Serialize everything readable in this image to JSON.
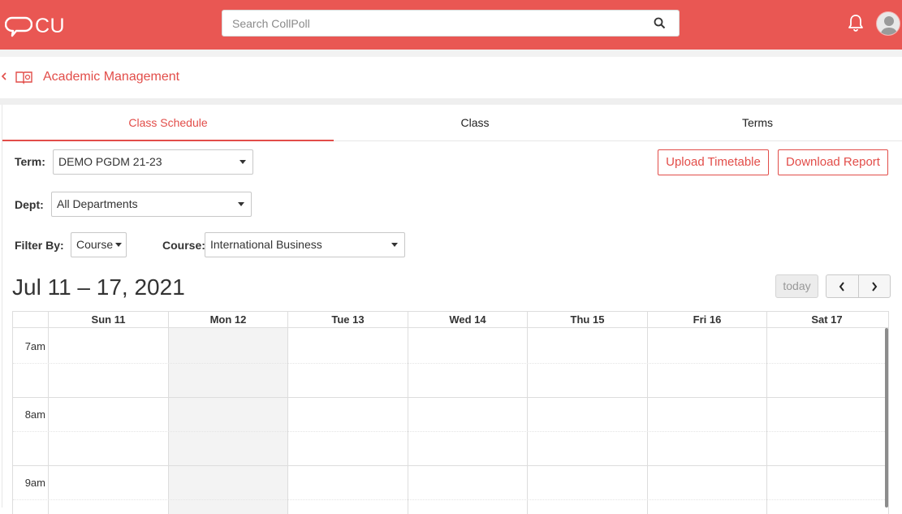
{
  "app": {
    "brand": "CU"
  },
  "header": {
    "search_placeholder": "Search CollPoll"
  },
  "breadcrumb": {
    "title": "Academic Management"
  },
  "tabs": [
    {
      "label": "Class Schedule",
      "active": true
    },
    {
      "label": "Class",
      "active": false
    },
    {
      "label": "Terms",
      "active": false
    }
  ],
  "filters": {
    "term_label": "Term:",
    "term_value": "DEMO PGDM 21-23",
    "dept_label": "Dept:",
    "dept_value": "All Departments",
    "filter_by_label": "Filter By:",
    "filter_by_value": "Course",
    "course_label": "Course:",
    "course_value": "International Business"
  },
  "actions": {
    "upload_label": "Upload Timetable",
    "download_label": "Download Report"
  },
  "calendar": {
    "range_title": "Jul 11 – 17, 2021",
    "today_label": "today",
    "days": [
      "Sun 11",
      "Mon 12",
      "Tue 13",
      "Wed 14",
      "Thu 15",
      "Fri 16",
      "Sat 17"
    ],
    "highlighted_day": "Mon 12",
    "times": [
      "7am",
      "8am",
      "9am"
    ]
  },
  "colors": {
    "brand": "#e95753",
    "accent": "#e24d49"
  }
}
